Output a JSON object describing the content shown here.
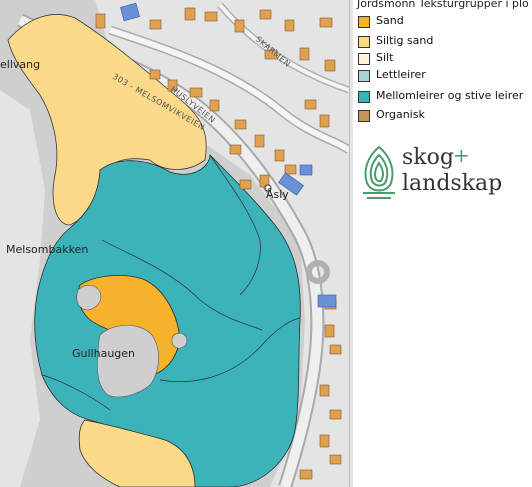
{
  "legend": {
    "title": "Jordsmonn Teksturgrupper i plo",
    "items": [
      {
        "label": "Sand",
        "color": "#f7b22c"
      },
      {
        "label": "Siltig sand",
        "color": "#fbd98a"
      },
      {
        "label": "Silt",
        "color": "#fdf5d8"
      },
      {
        "label": "Lettleirer",
        "color": "#a8d4d4"
      },
      {
        "label": "Mellomleirer og stive leirer",
        "color": "#3bb3b9"
      },
      {
        "label": "Organisk",
        "color": "#c6955a"
      }
    ]
  },
  "logo": {
    "line1": "skog",
    "plus": "+",
    "line2": "landskap",
    "color": "#4a9c6a"
  },
  "map": {
    "places": {
      "ellvang": "ellvang",
      "melsombakken": "Melsombakken",
      "gullhaugen": "Gullhaugen",
      "asly": "Åsly"
    },
    "roads": {
      "main": "303 - MELSOMVIKVEIEN",
      "husly": "HUSLYVEIEN",
      "skarmen": "SKARMEN"
    }
  }
}
